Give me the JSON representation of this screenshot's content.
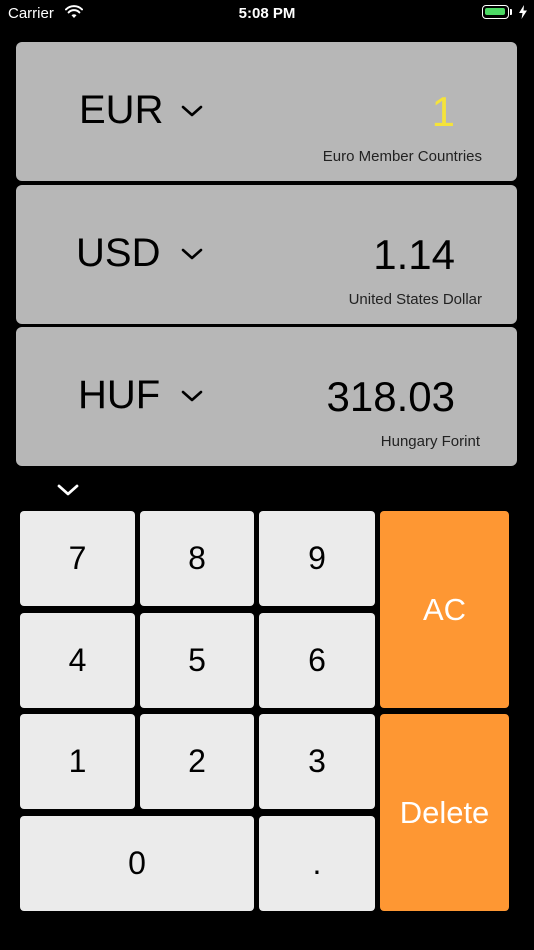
{
  "status": {
    "carrier": "Carrier",
    "time": "5:08 PM"
  },
  "currencies": [
    {
      "code": "EUR",
      "amount": "1",
      "name": "Euro Member Countries",
      "active": true
    },
    {
      "code": "USD",
      "amount": "1.14",
      "name": "United States Dollar",
      "active": false
    },
    {
      "code": "HUF",
      "amount": "318.03",
      "name": "Hungary Forint",
      "active": false
    }
  ],
  "keypad": {
    "k7": "7",
    "k8": "8",
    "k9": "9",
    "k4": "4",
    "k5": "5",
    "k6": "6",
    "k1": "1",
    "k2": "2",
    "k3": "3",
    "k0": "0",
    "dot": ".",
    "clear": "AC",
    "delete": "Delete"
  },
  "colors": {
    "background": "#000000",
    "card": "#b7b7b7",
    "active_amount": "#f5e33a",
    "key": "#ebebeb",
    "operator_key": "#fe9733"
  },
  "icons": [
    "wifi-icon",
    "battery-icon",
    "charging-bolt-icon",
    "chevron-down-icon"
  ]
}
